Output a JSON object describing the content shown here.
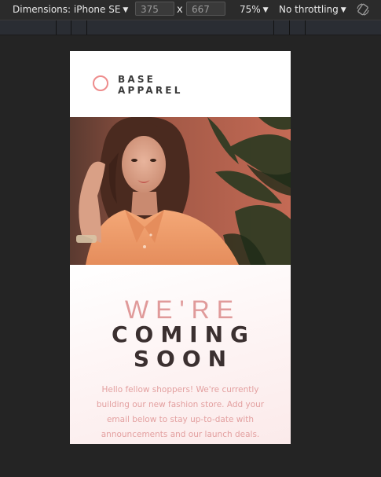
{
  "devtools": {
    "dimensions_label": "Dimensions: iPhone SE",
    "width_value": "375",
    "height_value": "667",
    "times_symbol": "x",
    "zoom_label": "75%",
    "throttling_label": "No throttling",
    "rotate_icon": "rotate-icon"
  },
  "page": {
    "logo_line1": "BASE",
    "logo_line2": "APPAREL",
    "heading_light": "WE'RE",
    "heading_bold_line1": "COMING",
    "heading_bold_line2": "SOON",
    "description": "Hello fellow shoppers! We're currently building our new fashion store. Add your email below to stay up-to-date with announcements and our launch deals."
  },
  "colors": {
    "accent": "#ee8c8c",
    "heading_dark": "#3b3030",
    "text_pink": "#e3a0a0"
  }
}
